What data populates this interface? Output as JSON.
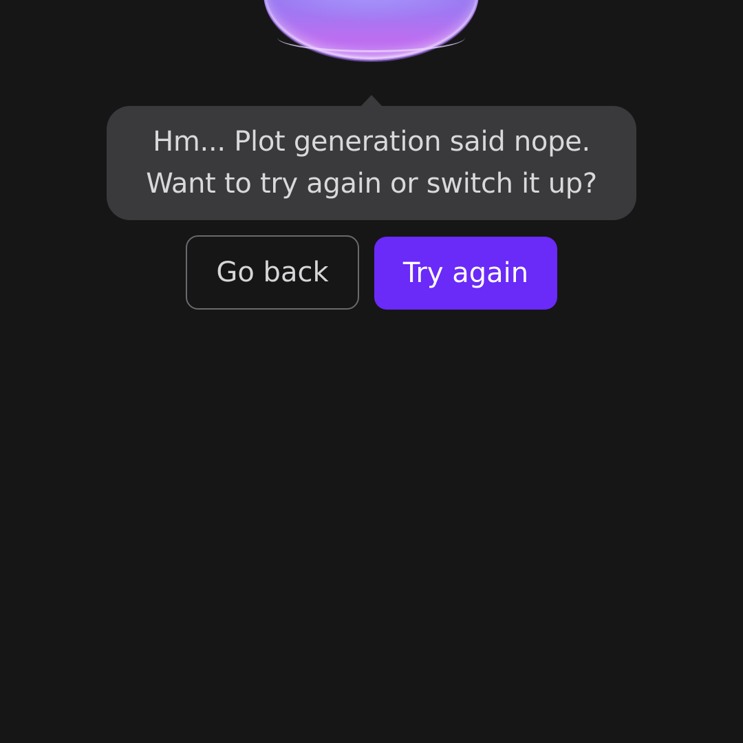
{
  "mascot": {
    "icon": "mascot-blob-icon",
    "color": "#a178f2"
  },
  "message": {
    "line1": "Hm... Plot generation said nope.",
    "line2": "Want to try again or switch it up?"
  },
  "actions": {
    "go_back_label": "Go back",
    "try_again_label": "Try again",
    "primary_color": "#6a2af7"
  }
}
